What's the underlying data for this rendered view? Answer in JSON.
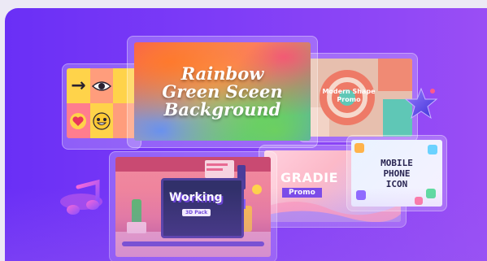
{
  "hero": {
    "bg_from": "#6a2ff6",
    "bg_to": "#9a4ef5"
  },
  "cards": {
    "rainbow": {
      "title_lines": [
        "Rainbow",
        "Green Sceen",
        "Background"
      ]
    },
    "modern_shape": {
      "title_lines": [
        "Modern Shape",
        "Promo"
      ]
    },
    "working": {
      "title": "Working",
      "subtitle": "3D Pack"
    },
    "gradient": {
      "title": "GRADIE",
      "promo": "Promo"
    },
    "mobile": {
      "title_lines": [
        "MOBILE",
        "PHONE",
        "ICON"
      ]
    },
    "emoji": {
      "icons": [
        "arrow-right-icon",
        "eye-icon",
        "empty-tile",
        "heart-icon",
        "grinning-face-icon",
        "empty-tile"
      ]
    }
  },
  "decor": [
    "music-note-icon",
    "star-icon"
  ]
}
